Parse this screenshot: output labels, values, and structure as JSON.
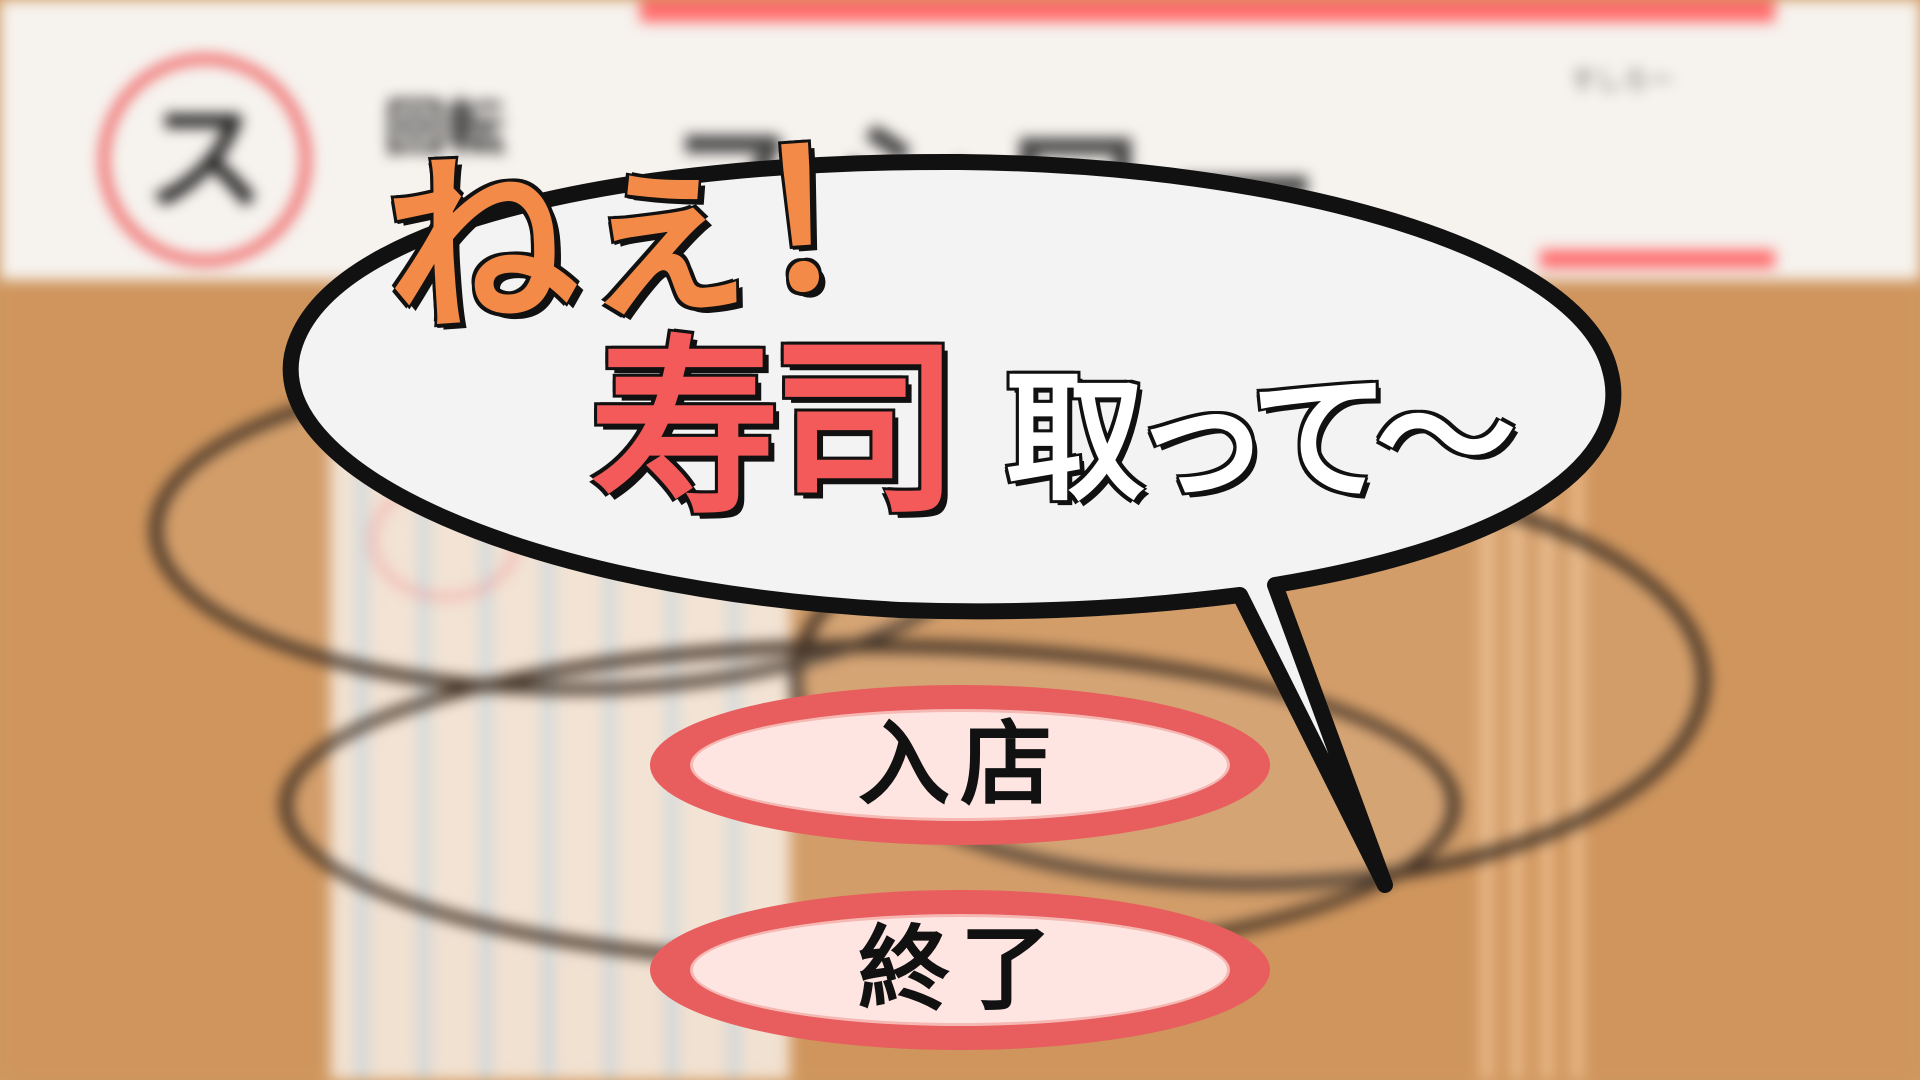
{
  "background_sign": {
    "logo_letter": "ス",
    "prefix": "回転",
    "name": "スシロー",
    "ruby": "すしろー"
  },
  "title": {
    "line1": "ねぇ！",
    "line2": "寿司",
    "line3": "取って～"
  },
  "menu": {
    "enter_label": "入店",
    "quit_label": "終了"
  },
  "colors": {
    "title_orange": "#f38a47",
    "title_red": "#f45a5a",
    "button_ring": "#e85d5d",
    "button_fill": "#ffe5e2",
    "counter_wood": "#cf955d"
  }
}
